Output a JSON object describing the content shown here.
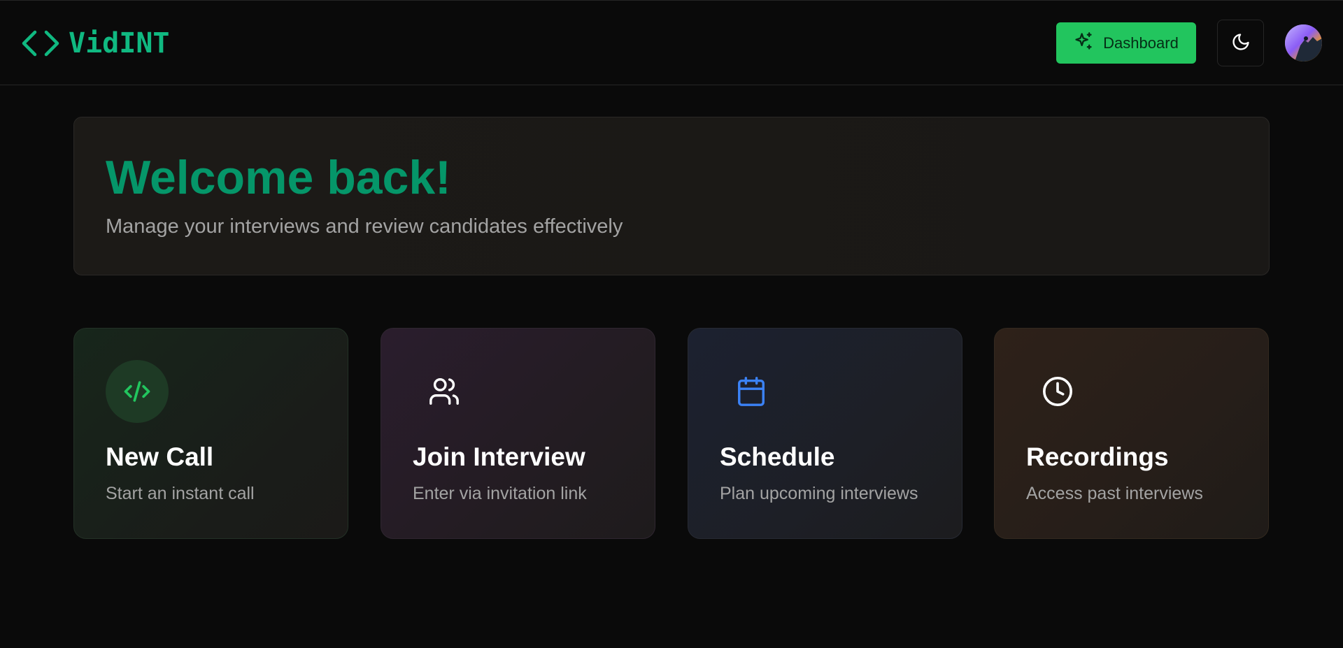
{
  "header": {
    "logo_icon": "code-brackets-icon",
    "logo_text": "VidINT",
    "dashboard_label": "Dashboard",
    "dashboard_icon": "sparkles-icon",
    "theme_icon": "moon-icon"
  },
  "welcome": {
    "title": "Welcome back!",
    "subtitle": "Manage your interviews and review candidates effectively"
  },
  "cards": [
    {
      "title": "New Call",
      "description": "Start an instant call",
      "icon": "code-icon",
      "accent": "#22c55e"
    },
    {
      "title": "Join Interview",
      "description": "Enter via invitation link",
      "icon": "users-icon",
      "accent": "#ffffff"
    },
    {
      "title": "Schedule",
      "description": "Plan upcoming interviews",
      "icon": "calendar-icon",
      "accent": "#3b82f6"
    },
    {
      "title": "Recordings",
      "description": "Access past interviews",
      "icon": "clock-icon",
      "accent": "#ffffff"
    }
  ],
  "colors": {
    "brand": "#10b981",
    "primary_button": "#22c55e",
    "welcome_title": "#059669",
    "background": "#0a0a0a"
  }
}
